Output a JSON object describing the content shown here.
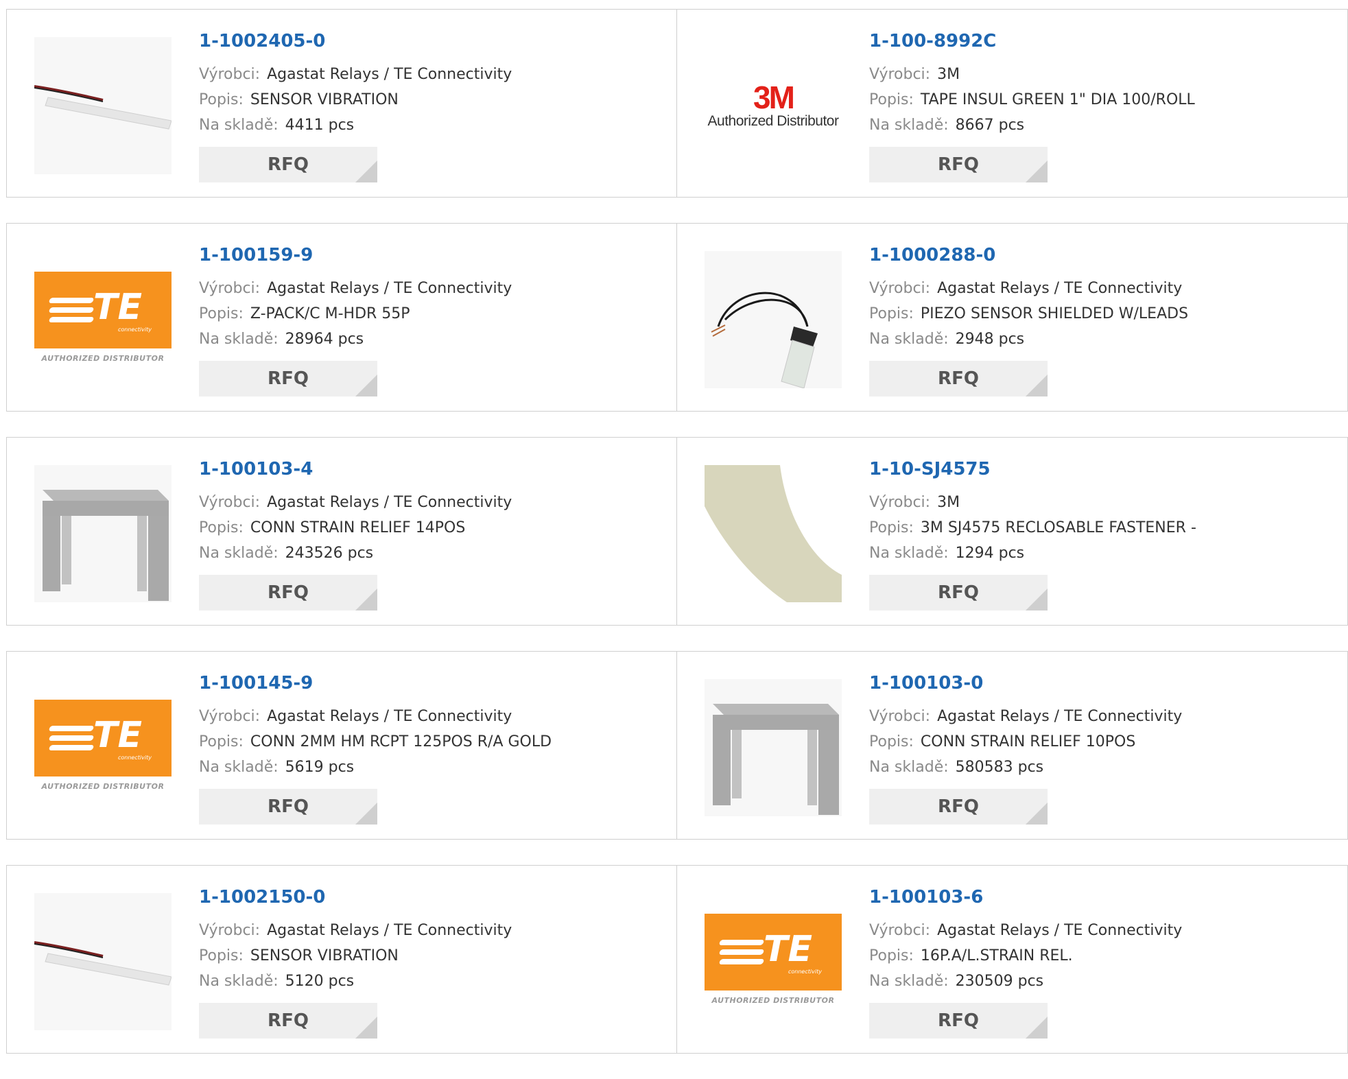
{
  "labels": {
    "manufacturer": "Výrobci:",
    "description": "Popis:",
    "stock": "Na skladě:"
  },
  "rfq_label": "RFQ",
  "colors": {
    "link": "#1f67b1",
    "te_orange": "#f6921e",
    "brand_3m": "#e32119",
    "rfq_bg": "#efefef"
  },
  "logo_text": {
    "te": "TE",
    "te_sub": "connectivity",
    "te_authorized": "AUTHORIZED DISTRIBUTOR",
    "mm": "3M",
    "mm_authorized": "Authorized Distributor"
  },
  "products": [
    {
      "part": "1-1002405-0",
      "manufacturer": "Agastat Relays / TE Connectivity",
      "description": "SENSOR VIBRATION",
      "stock": "4411 pcs",
      "image": "vibration-sensor"
    },
    {
      "part": "1-100-8992C",
      "manufacturer": "3M",
      "description": "TAPE INSUL GREEN 1\" DIA 100/ROLL",
      "stock": "8667 pcs",
      "image": "3m-logo"
    },
    {
      "part": "1-100159-9",
      "manufacturer": "Agastat Relays / TE Connectivity",
      "description": "Z-PACK/C M-HDR 55P",
      "stock": "28964 pcs",
      "image": "te-logo"
    },
    {
      "part": "1-1000288-0",
      "manufacturer": "Agastat Relays / TE Connectivity",
      "description": "PIEZO SENSOR SHIELDED W/LEADS",
      "stock": "2948 pcs",
      "image": "piezo-sensor"
    },
    {
      "part": "1-100103-4",
      "manufacturer": "Agastat Relays / TE Connectivity",
      "description": "CONN STRAIN RELIEF 14POS",
      "stock": "243526 pcs",
      "image": "strain-relief"
    },
    {
      "part": "1-10-SJ4575",
      "manufacturer": "3M",
      "description": "3M SJ4575 RECLOSABLE FASTENER -",
      "stock": "1294 pcs",
      "image": "fastener-tape"
    },
    {
      "part": "1-100145-9",
      "manufacturer": "Agastat Relays / TE Connectivity",
      "description": "CONN 2MM HM RCPT 125POS R/A GOLD",
      "stock": "5619 pcs",
      "image": "te-logo"
    },
    {
      "part": "1-100103-0",
      "manufacturer": "Agastat Relays / TE Connectivity",
      "description": "CONN STRAIN RELIEF 10POS",
      "stock": "580583 pcs",
      "image": "strain-relief"
    },
    {
      "part": "1-1002150-0",
      "manufacturer": "Agastat Relays / TE Connectivity",
      "description": "SENSOR VIBRATION",
      "stock": "5120 pcs",
      "image": "vibration-sensor"
    },
    {
      "part": "1-100103-6",
      "manufacturer": "Agastat Relays / TE Connectivity",
      "description": "16P.A/L.STRAIN REL.",
      "stock": "230509 pcs",
      "image": "te-logo"
    }
  ]
}
